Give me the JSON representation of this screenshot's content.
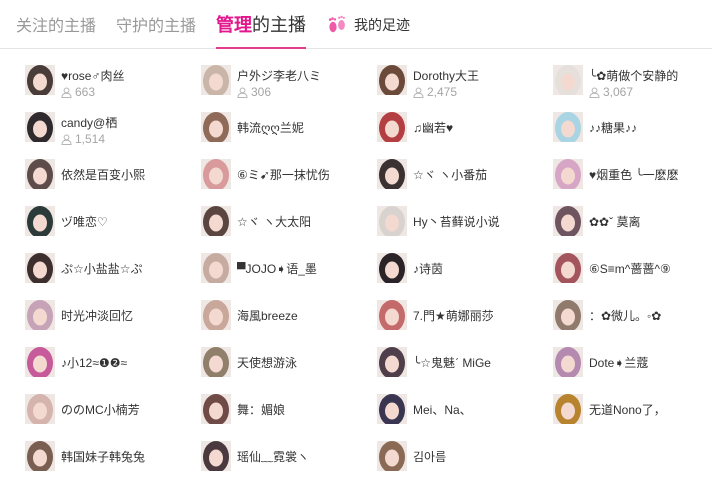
{
  "tabs": {
    "followed": "关注的主播",
    "guarded": "守护的主播",
    "managed_hl": "管理",
    "managed_rest": "的主播",
    "footprints": "我的足迹"
  },
  "colors": {
    "accent": "#e3178d",
    "muted": "#999999",
    "count": "#a5a5a5"
  },
  "anchors": [
    {
      "name": "♥rose♂肉丝",
      "count": "663",
      "avatar": "#4a3c38"
    },
    {
      "name": "户外ジ李老八ミ",
      "count": "306",
      "avatar": "#c9b6a8"
    },
    {
      "name": "Dorothy大王",
      "count": "2,475",
      "avatar": "#6b4a3a"
    },
    {
      "name": "╰✿萌做个安静的",
      "count": "3,067",
      "avatar": "#e6e0dc"
    },
    {
      "name": "candy@栖",
      "count": "1,514",
      "avatar": "#2e2a2e"
    },
    {
      "name": "韩流ღღ兰妮",
      "count": "",
      "avatar": "#8f6a58"
    },
    {
      "name": "♫幽若♥",
      "count": "",
      "avatar": "#b33f43"
    },
    {
      "name": "♪♪糖果♪♪",
      "count": "",
      "avatar": "#a9d4e3"
    },
    {
      "name": "依然是百变小熙",
      "count": "",
      "avatar": "#5d4c4a"
    },
    {
      "name": "⑥ミ➹那一抹忧伤",
      "count": "",
      "avatar": "#d89a9a"
    },
    {
      "name": "☆ヾ ヽ小番茄",
      "count": "",
      "avatar": "#3b3032"
    },
    {
      "name": "♥烟重色 ╰一麽麽",
      "count": "",
      "avatar": "#d7a5c6"
    },
    {
      "name": "ヅ唯恋♡",
      "count": "",
      "avatar": "#2d3a3a"
    },
    {
      "name": "☆ヾ ヽ大太阳",
      "count": "",
      "avatar": "#5a4541"
    },
    {
      "name": "Hy丶苔藓说小说",
      "count": "",
      "avatar": "#d9d3cf"
    },
    {
      "name": "✿✿ˇ 莫离",
      "count": "",
      "avatar": "#6f5560"
    },
    {
      "name": "ぷ☆小盐盐☆ぷ",
      "count": "",
      "avatar": "#3e2f2f"
    },
    {
      "name": "▀JOJO➧语_墨",
      "count": "",
      "avatar": "#c6aba1"
    },
    {
      "name": "♪诗茵",
      "count": "",
      "avatar": "#2a2428"
    },
    {
      "name": "⑥S≡m^蔷蔷^⑨",
      "count": "",
      "avatar": "#a4545c"
    },
    {
      "name": "时光冲淡回忆",
      "count": "",
      "avatar": "#c7a3b7"
    },
    {
      "name": "海風breeze",
      "count": "",
      "avatar": "#c9a79a"
    },
    {
      "name": "7.門★萌娜丽莎",
      "count": "",
      "avatar": "#c46a6a"
    },
    {
      "name": "：✿微儿。◦✿",
      "count": "",
      "avatar": "#8f7a6c"
    },
    {
      "name": "♪小12≈❶❷≈",
      "count": "",
      "avatar": "#c65a9a"
    },
    {
      "name": "天使想游泳",
      "count": "",
      "avatar": "#8f7f6b"
    },
    {
      "name": "╰☆鬼魅ˊ MiGe",
      "count": "",
      "avatar": "#4f3f4a"
    },
    {
      "name": "Dote➧兰蔻",
      "count": "",
      "avatar": "#b58ab0"
    },
    {
      "name": "ののMC小楠芳",
      "count": "",
      "avatar": "#d4b4ad"
    },
    {
      "name": "舞：媚娘",
      "count": "",
      "avatar": "#6f4a46"
    },
    {
      "name": "Mei、Na、",
      "count": "",
      "avatar": "#3a3550"
    },
    {
      "name": "无道Nono了，",
      "count": "",
      "avatar": "#b8832e"
    },
    {
      "name": "韩国妹子韩兔兔",
      "count": "",
      "avatar": "#7a5e52"
    },
    {
      "name": "瑶仙﹏霓裳ヽ",
      "count": "",
      "avatar": "#4a3a3f"
    },
    {
      "name": "김아름",
      "count": "",
      "avatar": "#8a6a55"
    }
  ]
}
